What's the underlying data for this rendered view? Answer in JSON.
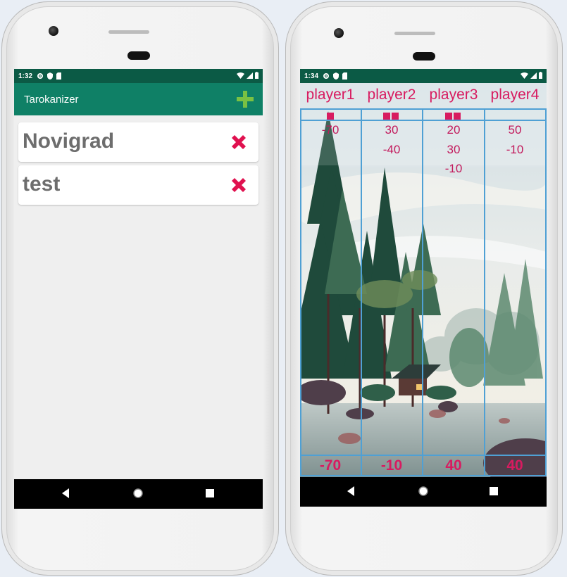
{
  "left_phone": {
    "status_time": "1:32",
    "app_title": "Tarokanizer",
    "games": [
      {
        "name": "Novigrad"
      },
      {
        "name": "test"
      }
    ]
  },
  "right_phone": {
    "status_time": "1:34",
    "players": [
      "player1",
      "player2",
      "player3",
      "player4"
    ],
    "dealer_marks": [
      1,
      2,
      2,
      0
    ],
    "scores": [
      [
        "-70"
      ],
      [
        "30",
        "-40"
      ],
      [
        "20",
        "30",
        "-10"
      ],
      [
        "50",
        "-10"
      ]
    ],
    "totals": [
      "-70",
      "-10",
      "40",
      "40"
    ]
  },
  "colors": {
    "appbar": "#0f8066",
    "statusbar": "#0b5a45",
    "accent_pink": "#d81b60",
    "add_green": "#7ac143",
    "grid_blue": "#4fa0d4"
  },
  "icons": [
    "settings-icon",
    "shield-icon",
    "sd-card-icon",
    "wifi-icon",
    "signal-icon",
    "battery-icon",
    "add-icon",
    "delete-icon",
    "back-icon",
    "home-icon",
    "recents-icon"
  ]
}
